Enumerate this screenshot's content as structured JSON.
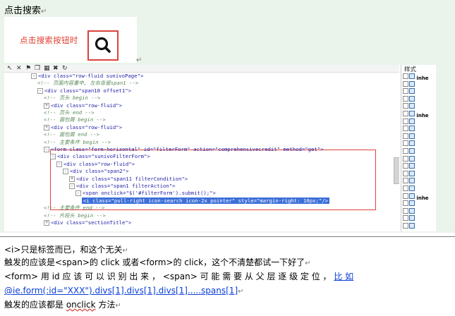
{
  "heading": "点击搜索",
  "para_mark": "↵",
  "callout": {
    "text": "点击搜索按钮时",
    "icon": "search-icon"
  },
  "ide": {
    "toolbar_icons": [
      "pointer-icon",
      "close-icon",
      "bookmark-icon",
      "copy-icon",
      "grid-icon",
      "delete-icon",
      "refresh-icon"
    ],
    "lines": [
      {
        "indent": 0,
        "toggle": "-",
        "kind": "tag",
        "text": "<div class=\"row-fluid sunivoPage\">"
      },
      {
        "indent": 1,
        "toggle": "",
        "kind": "cmt",
        "text": "<!-- 页面内容重中, 左右各留span1 -->"
      },
      {
        "indent": 1,
        "toggle": "-",
        "kind": "tag",
        "text": "<div class=\"span10 offset1\">"
      },
      {
        "indent": 2,
        "toggle": "",
        "kind": "cmt",
        "text": "<!-- 页头 begin -->"
      },
      {
        "indent": 2,
        "toggle": "+",
        "kind": "tag",
        "text": "<div class=\"row-fluid\">"
      },
      {
        "indent": 2,
        "toggle": "",
        "kind": "cmt",
        "text": "<!-- 页头 end -->"
      },
      {
        "indent": 2,
        "toggle": "",
        "kind": "cmt",
        "text": "<!-- 面包屑 begin -->"
      },
      {
        "indent": 2,
        "toggle": "+",
        "kind": "tag",
        "text": "<div class=\"row-fluid\">"
      },
      {
        "indent": 2,
        "toggle": "",
        "kind": "cmt",
        "text": "<!-- 面包屑 end -->"
      },
      {
        "indent": 2,
        "toggle": "",
        "kind": "cmt",
        "text": "<!-- 主要条件 begin -->"
      },
      {
        "indent": 2,
        "toggle": "-",
        "kind": "tag",
        "text": "<form class=\"form-horizontal\" id=\"filterForm\" action=\"comprehensivecredit\" method=\"get\">"
      },
      {
        "indent": 3,
        "toggle": "-",
        "kind": "tag",
        "text": "<div class=\"sunivoFilterForm\">"
      },
      {
        "indent": 4,
        "toggle": "-",
        "kind": "tag",
        "text": "<div class=\"row-fluid\">"
      },
      {
        "indent": 5,
        "toggle": "-",
        "kind": "tag",
        "text": "<div class=\"span2\">"
      },
      {
        "indent": 6,
        "toggle": "+",
        "kind": "tag",
        "text": "<div class=\"span11 filterCondition\">"
      },
      {
        "indent": 6,
        "toggle": "-",
        "kind": "tag",
        "text": "<div class=\"span1 filterAction\">"
      },
      {
        "indent": 7,
        "toggle": "-",
        "kind": "tag",
        "text": "<span onclick=\"$('#filterForm').submit();\">"
      },
      {
        "indent": 8,
        "toggle": "",
        "kind": "hl",
        "text": "<i class=\"pull-right icon-search icon-2x pointer\" style=\"margin-right: 10px;\"/>"
      },
      {
        "indent": 2,
        "toggle": "",
        "kind": "cmt",
        "text": "<!-- 主要条件 end -->"
      },
      {
        "indent": 2,
        "toggle": "",
        "kind": "cmt",
        "text": "<!-- 片段头 begin -->"
      },
      {
        "indent": 2,
        "toggle": "+",
        "kind": "tag",
        "text": "<div class=\"sectionTitle\">"
      }
    ],
    "side_title": "样式",
    "side_rows": [
      "inhe",
      "",
      "",
      "",
      "",
      "inhe",
      "",
      "",
      "",
      "",
      "",
      "",
      "",
      "",
      "",
      "",
      "inhe",
      "",
      "",
      "",
      ""
    ]
  },
  "paragraphs": [
    {
      "segments": [
        {
          "t": "<i>只是标签而已，和这个无关"
        }
      ]
    },
    {
      "segments": [
        {
          "t": "触发的应该是<span>的 click 或者<form>的 click，这个不清楚都试一下好了"
        }
      ]
    },
    {
      "segments": [
        {
          "t": "<form> 用  id  应 该 可 以 识 别 出 来 ， <span> 可 能 需 要 从 父 层 逐 级 定 位 ， "
        },
        {
          "t": "比 如",
          "link": true
        }
      ]
    },
    {
      "segments": [
        {
          "t": "@ie.form(:id=\"XXX\").divs[1].divs[1].divs[1].....spans[1]",
          "link": true
        }
      ]
    },
    {
      "segments": [
        {
          "t": "触发的应该都是 "
        },
        {
          "t": "onclick",
          "wavy": true
        },
        {
          "t": " 方法"
        }
      ]
    }
  ]
}
